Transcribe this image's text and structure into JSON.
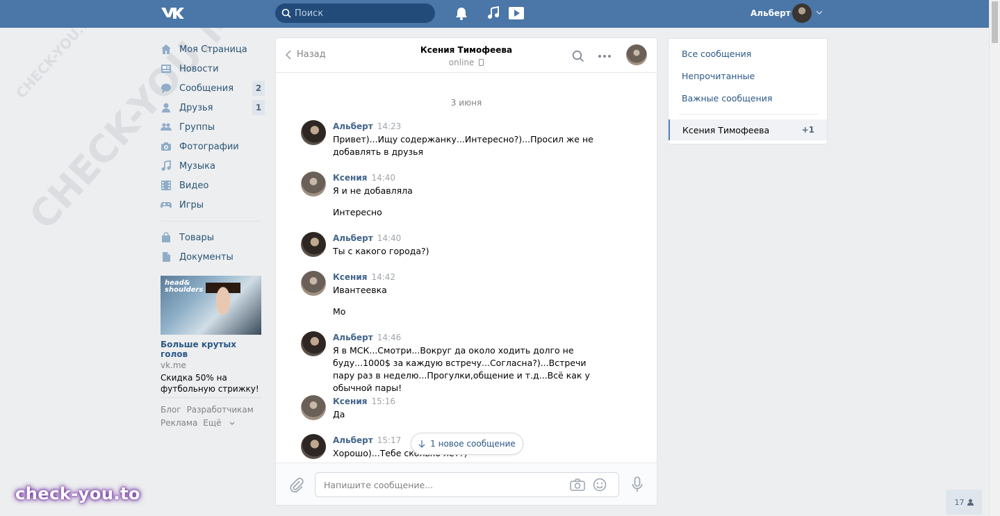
{
  "header": {
    "search_placeholder": "Поиск",
    "user_name": "Альберт"
  },
  "watermark": {
    "diagonal_big": "CHECK-YOU.ME",
    "diagonal_small": "CHECK-YOU.ME",
    "brand": "check-you.to"
  },
  "nav": {
    "items": [
      {
        "label": "Моя Страница",
        "icon": "home-icon",
        "count": ""
      },
      {
        "label": "Новости",
        "icon": "news-icon",
        "count": ""
      },
      {
        "label": "Сообщения",
        "icon": "messages-icon",
        "count": "2"
      },
      {
        "label": "Друзья",
        "icon": "friends-icon",
        "count": "1"
      },
      {
        "label": "Группы",
        "icon": "groups-icon",
        "count": ""
      },
      {
        "label": "Фотографии",
        "icon": "camera-icon",
        "count": ""
      },
      {
        "label": "Музыка",
        "icon": "music-icon",
        "count": ""
      },
      {
        "label": "Видео",
        "icon": "video-icon",
        "count": ""
      },
      {
        "label": "Игры",
        "icon": "gamepad-icon",
        "count": ""
      }
    ],
    "items2": [
      {
        "label": "Товары",
        "icon": "shopping-bag-icon"
      },
      {
        "label": "Документы",
        "icon": "document-icon"
      }
    ]
  },
  "ad": {
    "logo_line1": "head&",
    "logo_line2": "shoulders",
    "title": "Больше крутых голов",
    "domain": "vk.me",
    "text": "Скидка 50% на футбольную стрижку!"
  },
  "footer": {
    "blog": "Блог",
    "developers": "Разработчикам",
    "ads": "Реклама",
    "more": "Ещё"
  },
  "chat": {
    "back_label": "Назад",
    "title": "Ксения Тимофеева",
    "status": "online",
    "date": "3 июня",
    "messages": [
      {
        "author": "Альберт",
        "time": "14:23",
        "lines": [
          "Привет)...Ищу содержанку...Интересно?)...Просил же не добавлять в друзья"
        ]
      },
      {
        "author": "Ксения",
        "time": "14:40",
        "lines": [
          "Я и не добавляла",
          "Интересно"
        ]
      },
      {
        "author": "Альберт",
        "time": "14:40",
        "lines": [
          "Ты с какого города?)"
        ]
      },
      {
        "author": "Ксения",
        "time": "14:42",
        "lines": [
          "Ивантеевка",
          "Мо"
        ]
      },
      {
        "author": "Альберт",
        "time": "14:46",
        "lines": [
          "Я в МСК...Смотри...Вокруг да около ходить долго не буду...1000$ за каждую встречу...Согласна?)...Встречи пару раз в неделю...Прогулки,общение и т.д...Всё как у обычной пары!"
        ]
      },
      {
        "author": "Ксения",
        "time": "15:16",
        "lines": [
          "Да"
        ]
      },
      {
        "author": "Альберт",
        "time": "15:17",
        "lines": [
          "Хорошо)...Тебе сколько лет?)"
        ]
      }
    ],
    "new_message_label": "1 новое сообщение",
    "composer_placeholder": "Напишите сообщение..."
  },
  "right_menu": {
    "all": "Все сообщения",
    "unread": "Непрочитанные",
    "important": "Важные сообщения",
    "active_label": "Ксения Тимофеева",
    "active_count": "+1"
  },
  "online_count": "17",
  "colors": {
    "header_bg": "#4a76a8",
    "link": "#2a5885",
    "page_bg": "#edeef0"
  }
}
